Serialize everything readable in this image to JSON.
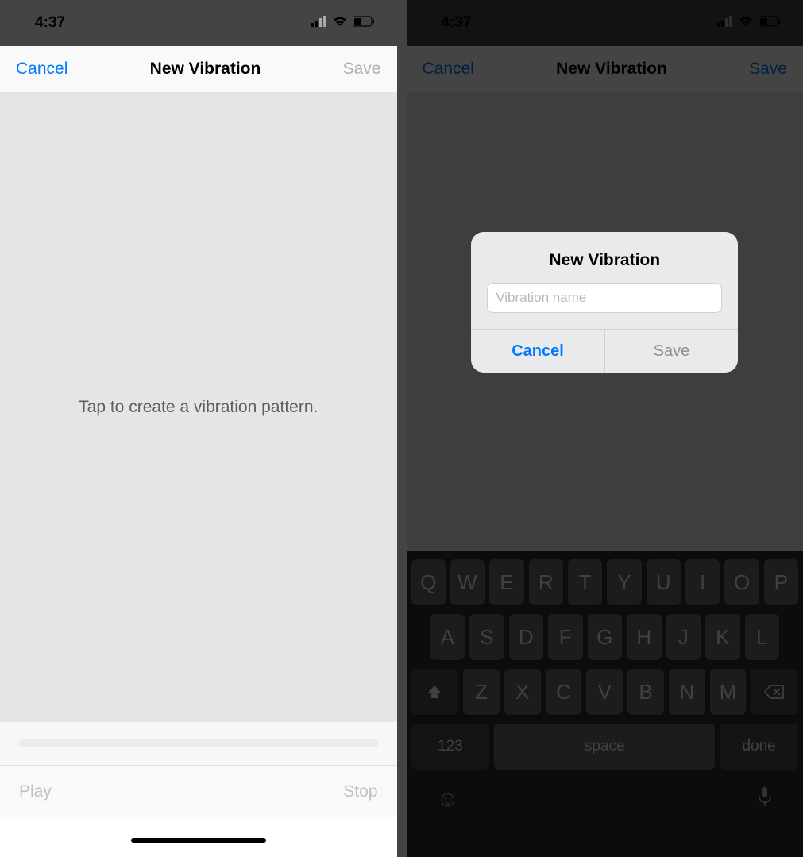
{
  "left": {
    "status": {
      "time": "4:37"
    },
    "nav": {
      "cancel": "Cancel",
      "title": "New Vibration",
      "save": "Save"
    },
    "content": {
      "prompt": "Tap to create a vibration pattern."
    },
    "bottom": {
      "play": "Play",
      "stop": "Stop"
    }
  },
  "right": {
    "status": {
      "time": "4:37"
    },
    "nav": {
      "cancel": "Cancel",
      "title": "New Vibration",
      "save": "Save"
    },
    "alert": {
      "title": "New Vibration",
      "placeholder": "Vibration name",
      "cancel": "Cancel",
      "save": "Save"
    },
    "keyboard": {
      "row1": [
        "Q",
        "W",
        "E",
        "R",
        "T",
        "Y",
        "U",
        "I",
        "O",
        "P"
      ],
      "row2": [
        "A",
        "S",
        "D",
        "F",
        "G",
        "H",
        "J",
        "K",
        "L"
      ],
      "row3": [
        "Z",
        "X",
        "C",
        "V",
        "B",
        "N",
        "M"
      ],
      "nums": "123",
      "space": "space",
      "done": "done"
    }
  }
}
